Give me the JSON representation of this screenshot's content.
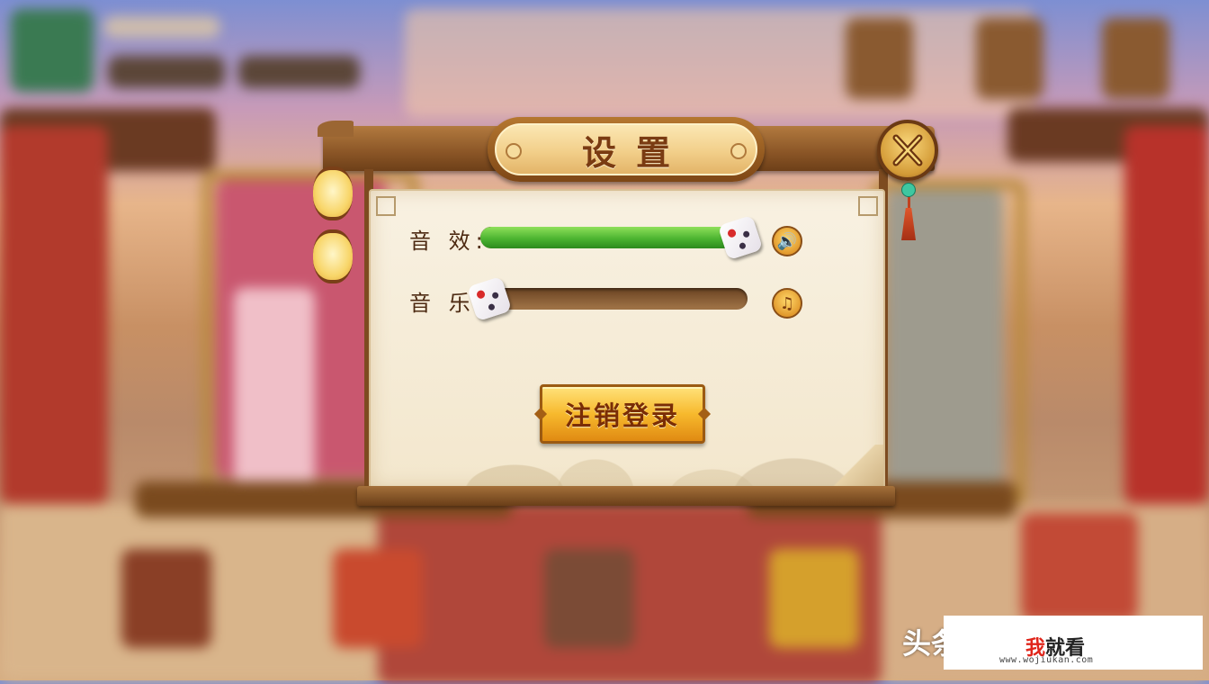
{
  "dialog": {
    "title": "设置",
    "close_icon": "close-x-icon",
    "sound_effect": {
      "label": "音 效:",
      "level": 1.0,
      "icon": "speaker-icon",
      "icon_glyph": "🔊"
    },
    "music": {
      "label": "音 乐:",
      "level": 0.0,
      "icon": "music-note-icon",
      "icon_glyph": "♫"
    },
    "logout_label": "注销登录"
  },
  "watermark": {
    "partial_text": "头条",
    "brand_accent": "我",
    "brand_rest": "就看",
    "url": "www.wojiukan.com"
  },
  "colors": {
    "fill_green": "#4cb431",
    "title_brown": "#7a3b12",
    "button_gold": "#f7b92d"
  }
}
